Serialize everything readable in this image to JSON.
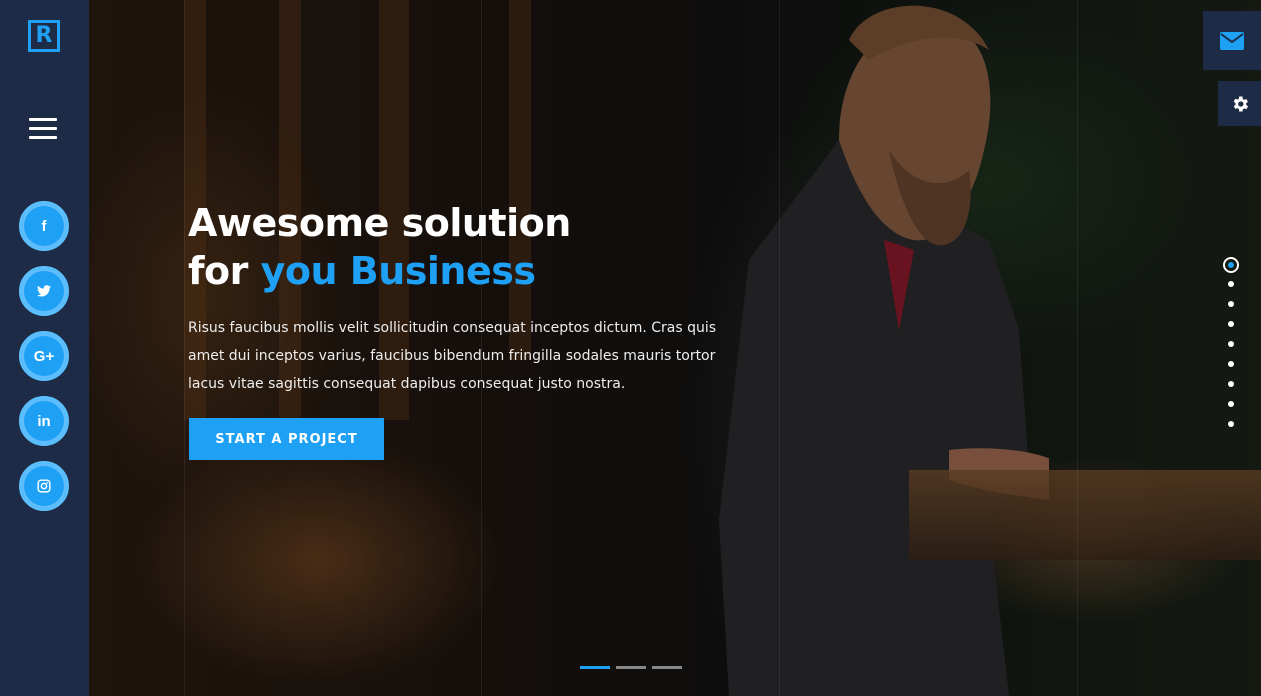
{
  "sidebar": {
    "logo_letter": "R",
    "menu_icon": "hamburger-icon",
    "social": [
      {
        "name": "facebook",
        "glyph": "f",
        "icon": "facebook-icon"
      },
      {
        "name": "twitter",
        "glyph": "",
        "icon": "twitter-icon"
      },
      {
        "name": "google-plus",
        "glyph": "G+",
        "icon": "google-plus-icon"
      },
      {
        "name": "linkedin",
        "glyph": "in",
        "icon": "linkedin-icon"
      },
      {
        "name": "instagram",
        "glyph": "",
        "icon": "instagram-icon"
      }
    ]
  },
  "hero": {
    "title_line1": "Awesome solution",
    "title_line2_prefix": "for ",
    "title_line2_accent": "you Business",
    "text": "Risus faucibus mollis velit sollicitudin consequat inceptos dictum. Cras quis amet dui inceptos varius, faucibus bibendum fringilla sodales mauris tortor lacus vitae sagittis consequat dapibus consequat justo nostra.",
    "cta_label": "START A PROJECT"
  },
  "slider": {
    "dot_count": 9,
    "active_index": 0
  },
  "pager": {
    "count": 3,
    "active_index": 0
  },
  "corner_buttons": {
    "mail_icon": "envelope-icon",
    "settings_icon": "gear-icon"
  },
  "colors": {
    "accent": "#1ea0f5",
    "sidebar": "#1d2b47"
  }
}
